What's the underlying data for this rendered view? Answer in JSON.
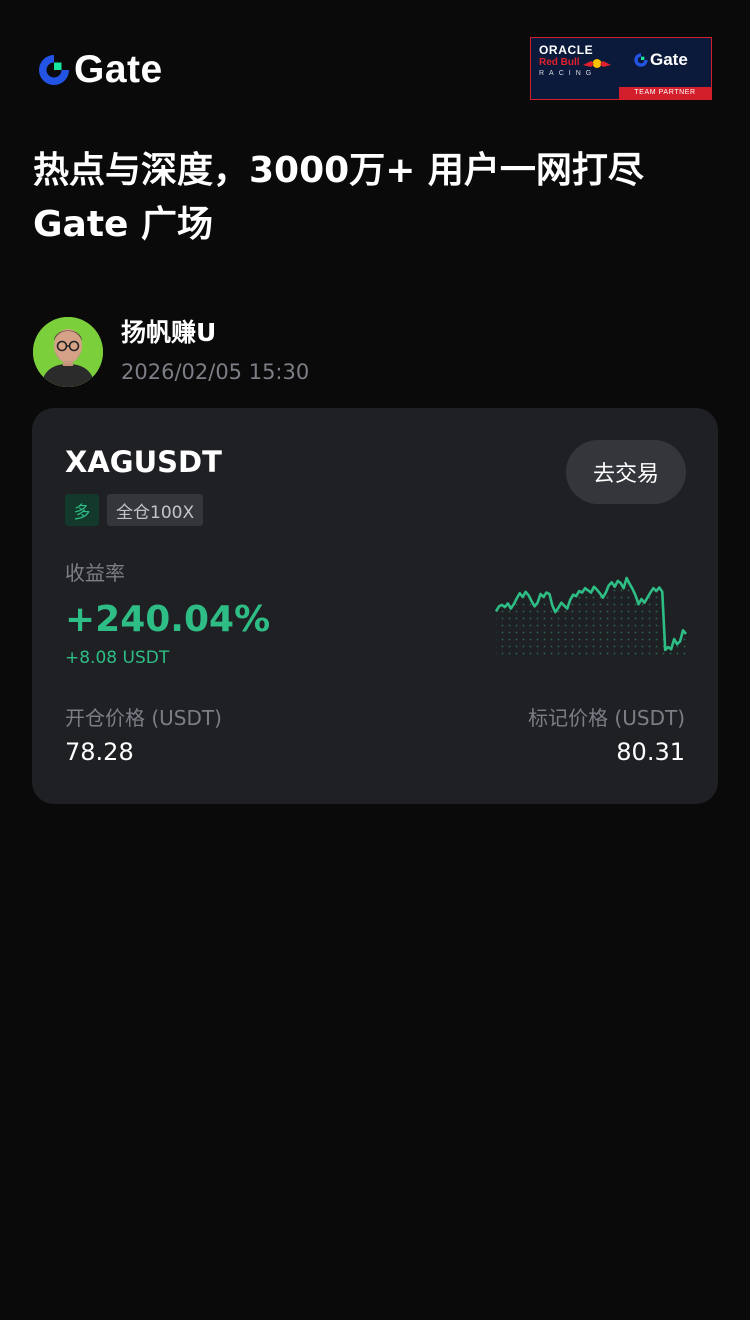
{
  "brand": {
    "logo_text": "Gate",
    "accent_color": "#2ebd85",
    "logo_blue": "#2354e6",
    "logo_green": "#17e6a1"
  },
  "partner_badge": {
    "oracle": "ORACLE",
    "redbull": "Red Bull",
    "racing": "RACING",
    "brand": "Gate",
    "tagline": "TEAM PARTNER"
  },
  "headline": {
    "line1": "热点与深度，3000万+ 用户一网打尽",
    "line2": "Gate 广场"
  },
  "author": {
    "name": "扬帆赚U",
    "time": "2026/02/05 15:30",
    "avatar_icon": "user-avatar"
  },
  "position": {
    "symbol": "XAGUSDT",
    "trade_button": "去交易",
    "side": "多",
    "mode": "全仓100X",
    "roi_label": "收益率",
    "roi_value": "+240.04%",
    "pnl": "+8.08 USDT",
    "entry_label": "开仓价格 (USDT)",
    "entry_price": "78.28",
    "mark_label": "标记价格 (USDT)",
    "mark_price": "80.31"
  },
  "chart_data": {
    "type": "line",
    "color": "#2ebd85",
    "series": [
      {
        "values": [
          6.2,
          6.9,
          7.1,
          6.8,
          7.3,
          6.6,
          7.2,
          8.0,
          8.7,
          8.2,
          8.9,
          8.4,
          7.6,
          6.9,
          7.4,
          8.6,
          8.2,
          8.8,
          8.6,
          7.0,
          6.1,
          6.7,
          7.4,
          7.0,
          6.6,
          7.8,
          8.5,
          8.3,
          9.0,
          8.8,
          9.4,
          9.1,
          8.8,
          9.6,
          9.2,
          8.7,
          8.1,
          8.8,
          9.8,
          10.2,
          9.6,
          10.4,
          10.1,
          9.4,
          10.8,
          10.0,
          9.3,
          8.4,
          7.2,
          7.9,
          7.4,
          8.1,
          8.8,
          9.4,
          9.0,
          9.5,
          8.9,
          0.9,
          1.3,
          1.0,
          2.4,
          1.7,
          2.1,
          3.6,
          3.1
        ]
      }
    ],
    "grid": "dotted"
  }
}
